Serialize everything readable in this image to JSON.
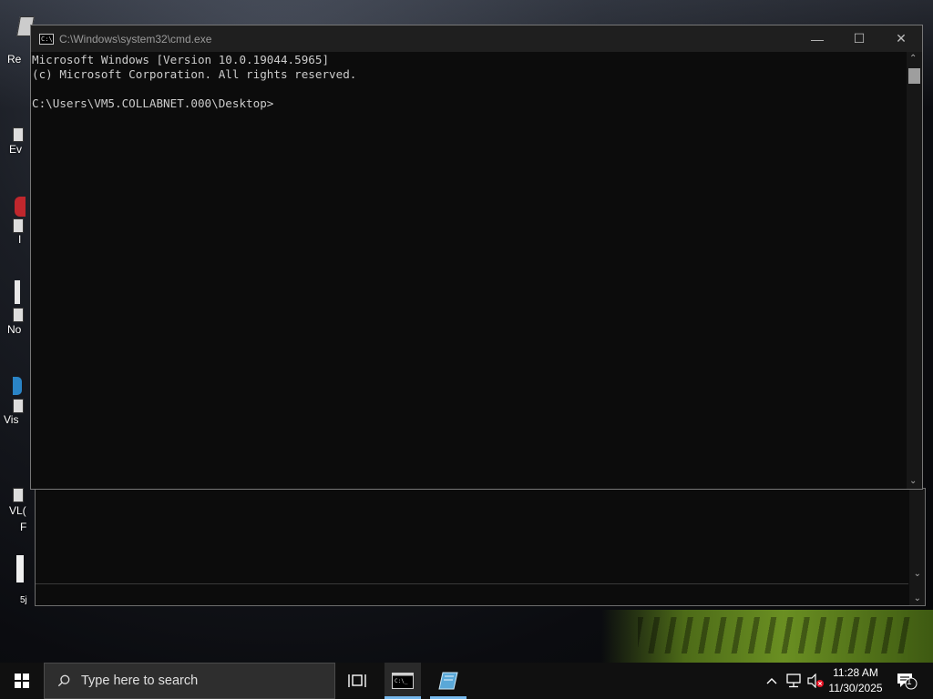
{
  "desktop": {
    "icons": [
      {
        "label": "Re"
      },
      {
        "label": "Ev"
      },
      {
        "label": "I"
      },
      {
        "label": "No"
      },
      {
        "label": "Vis"
      },
      {
        "label": "VL("
      },
      {
        "label": "F"
      },
      {
        "label": "5j"
      }
    ]
  },
  "window": {
    "title": "C:\\Windows\\system32\\cmd.exe",
    "icon": "cmd-icon",
    "controls": {
      "minimize": "—",
      "maximize": "☐",
      "close": "✕"
    },
    "console_lines": [
      "Microsoft Windows [Version 10.0.19044.5965]",
      "(c) Microsoft Corporation. All rights reserved.",
      "",
      "C:\\Users\\VM5.COLLABNET.000\\Desktop>"
    ]
  },
  "taskbar": {
    "search_placeholder": "Type here to search",
    "clock_time": "11:28 AM",
    "clock_date": "11/30/2025",
    "notification_count": "1",
    "accent": "#76b9ed"
  }
}
